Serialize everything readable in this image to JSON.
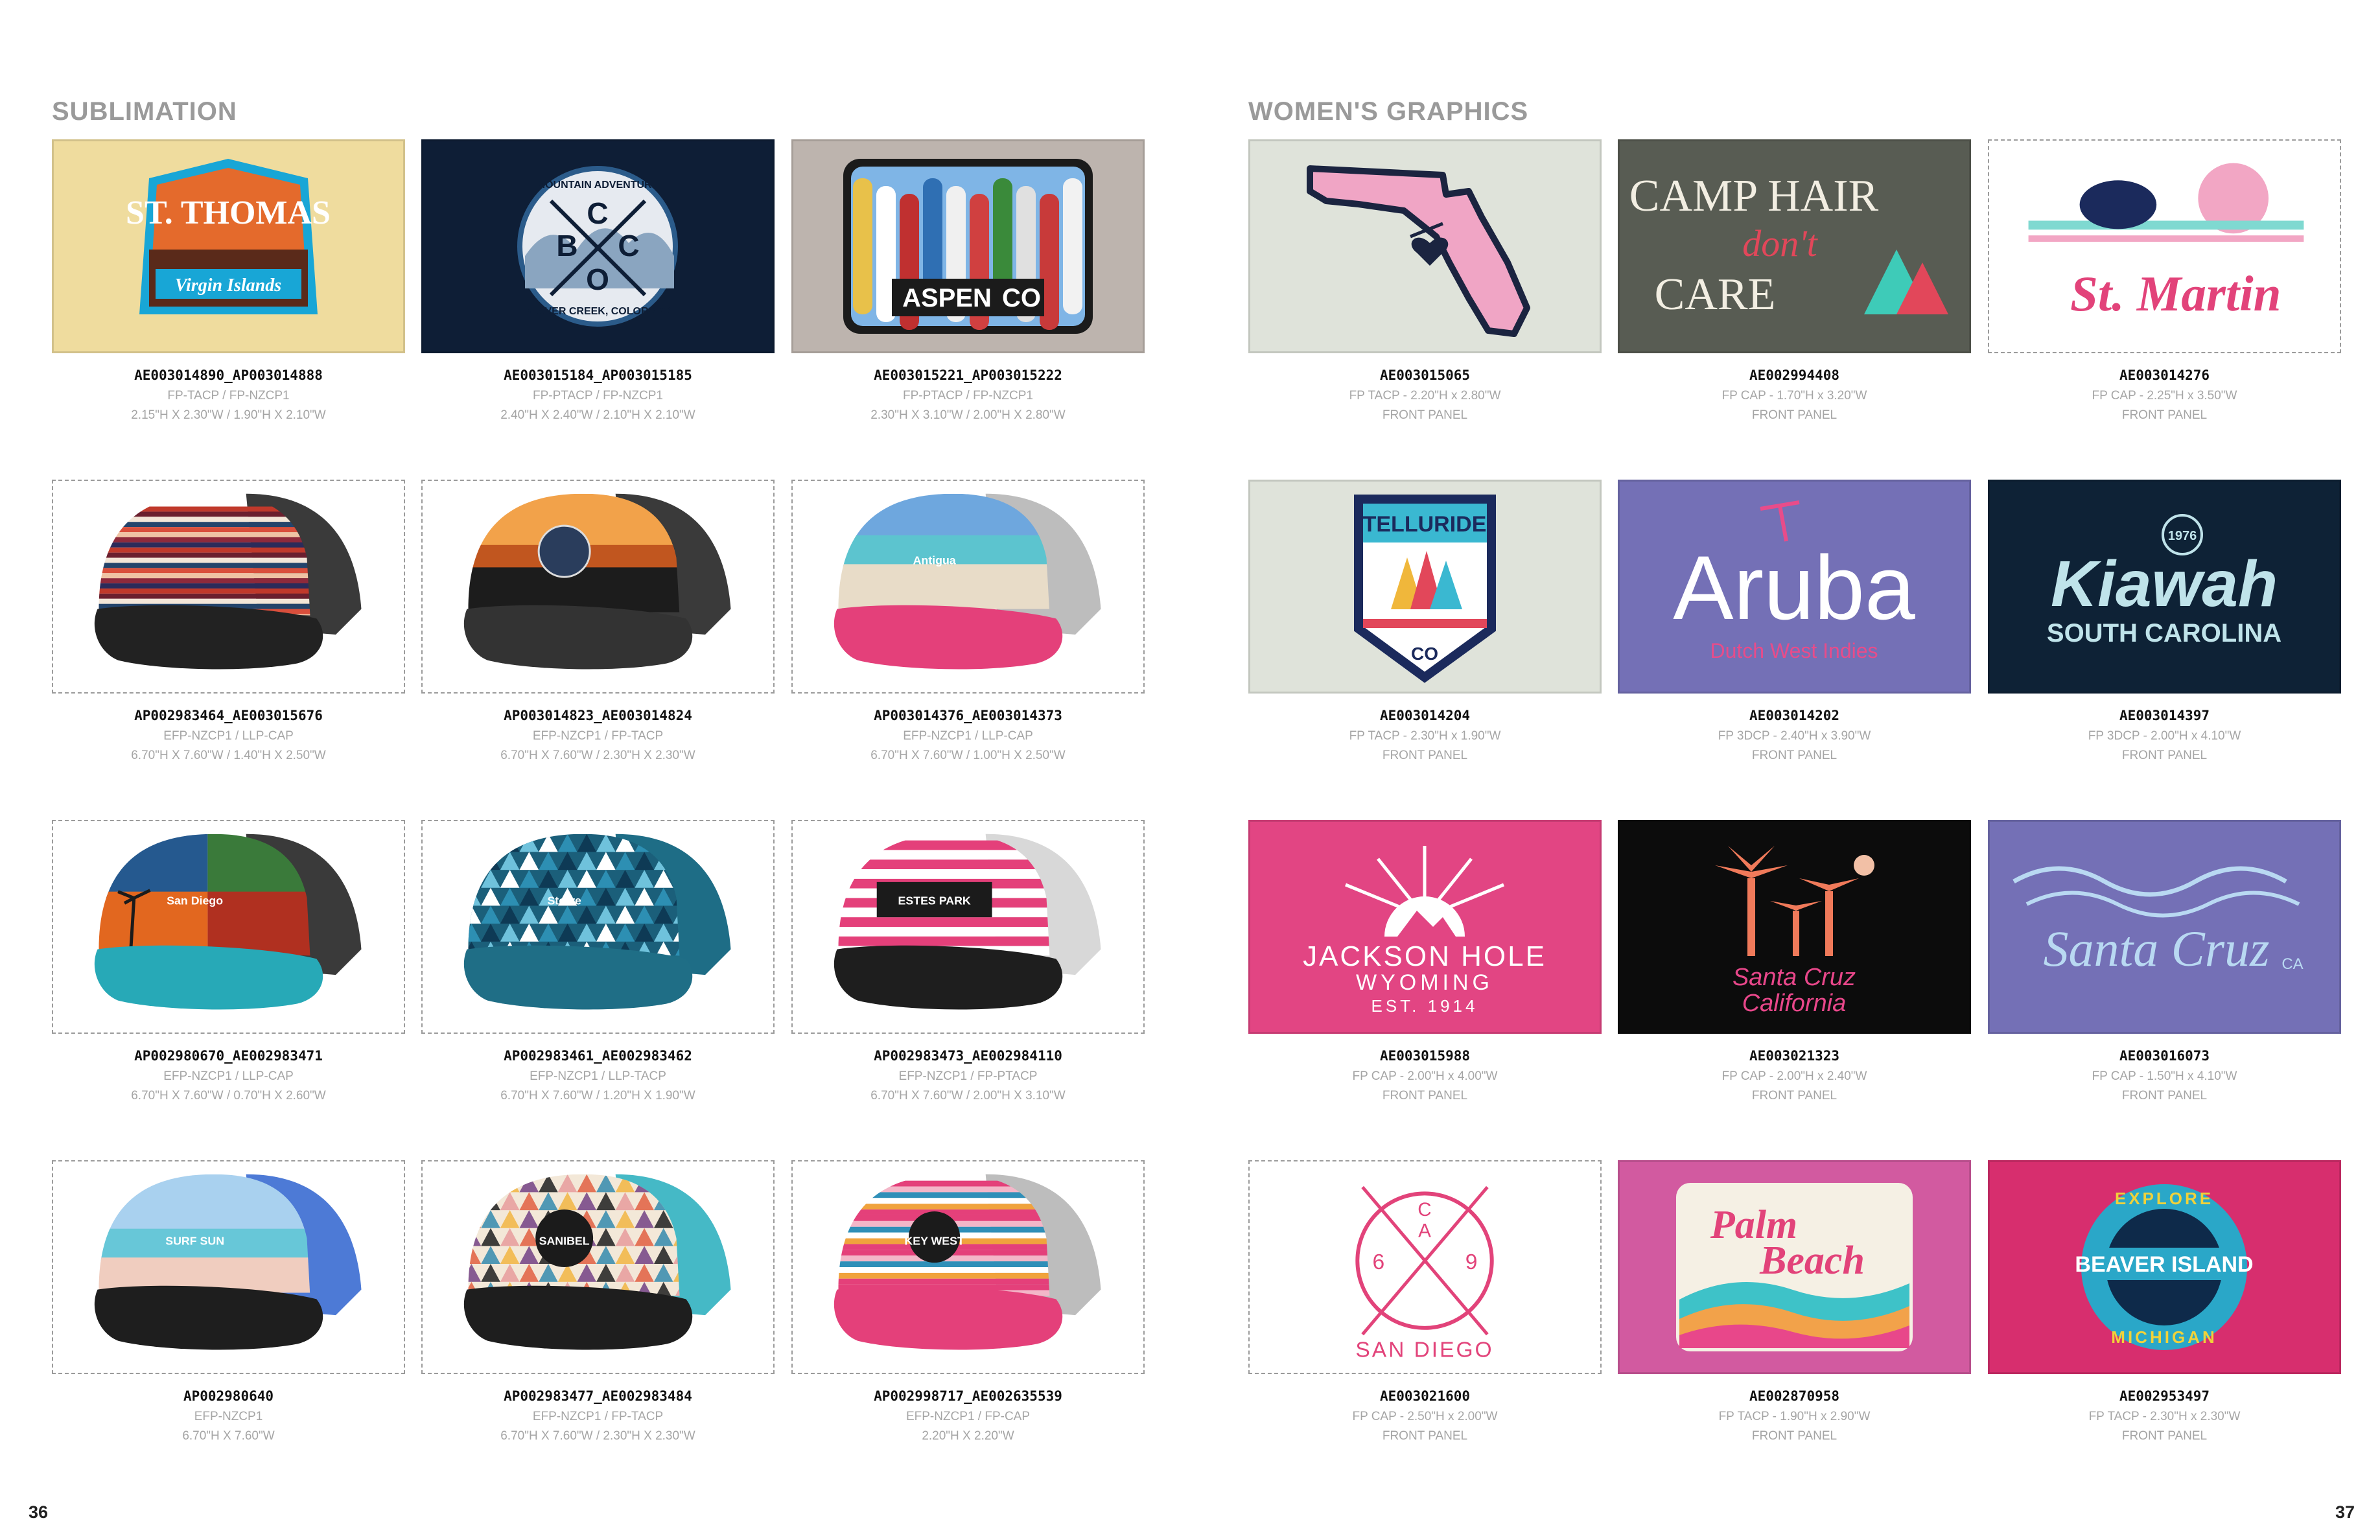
{
  "left_page": {
    "title": "SUBLIMATION",
    "page_number": "36",
    "items": [
      {
        "id": "AE003014890_AP003014888",
        "line1": "FP-TACP / FP-NZCP1",
        "line2": "2.15\"H X 2.30\"W / 1.90\"H X 2.10\"W",
        "art": {
          "kind": "stthomas",
          "text1": "ST. THOMAS",
          "text2": "Virgin Islands",
          "bg": "#efdc9e"
        }
      },
      {
        "id": "AE003015184_AP003015185",
        "line1": "FP-PTACP / FP-NZCP1",
        "line2": "2.40\"H X 2.40\"W / 2.10\"H X 2.10\"W",
        "art": {
          "kind": "bcco",
          "text1": "MOUNTAIN ADVENTURE",
          "text2": "BEAVER CREEK, COLORADO",
          "letters": [
            "B",
            "C",
            "C",
            "O"
          ],
          "bg": "#0e1e36"
        }
      },
      {
        "id": "AE003015221_AP003015222",
        "line1": "FP-PTACP / FP-NZCP1",
        "line2": "2.30\"H X 3.10\"W / 2.00\"H X 2.80\"W",
        "art": {
          "kind": "aspen",
          "text1": "ASPEN",
          "text2": "CO",
          "bg": "#bdb4ae"
        }
      },
      {
        "id": "AP002983464_AE003015676",
        "line1": "EFP-NZCP1 / LLP-CAP",
        "line2": "6.70\"H X 7.60\"W / 1.40\"H X 2.50\"W",
        "art": {
          "kind": "cap",
          "pattern": "serape",
          "mesh": "#3a3a3a",
          "bill": "#222222"
        }
      },
      {
        "id": "AP003014823_AE003014824",
        "line1": "EFP-NZCP1 / FP-TACP",
        "line2": "6.70\"H X 7.60\"W / 2.30\"H X 2.30\"W",
        "art": {
          "kind": "cap",
          "pattern": "sunset",
          "mesh": "#3a3a3a",
          "bill": "#333333"
        }
      },
      {
        "id": "AP003014376_AE003014373",
        "line1": "EFP-NZCP1 / LLP-CAP",
        "line2": "6.70\"H X 7.60\"W / 1.00\"H X 2.50\"W",
        "art": {
          "kind": "cap",
          "pattern": "beach",
          "mesh": "#bdbdbd",
          "bill": "#e4407a",
          "label": "Antigua"
        }
      },
      {
        "id": "AP002980670_AE002983471",
        "line1": "EFP-NZCP1 / LLP-CAP",
        "line2": "6.70\"H X 7.60\"W / 0.70\"H X 2.60\"W",
        "art": {
          "kind": "cap",
          "pattern": "collage",
          "mesh": "#3a3a3a",
          "bill": "#27a9b7",
          "label": "San Diego"
        }
      },
      {
        "id": "AP002983461_AE002983462",
        "line1": "EFP-NZCP1 / LLP-TACP",
        "line2": "6.70\"H X 7.60\"W / 1.20\"H X 1.90\"W",
        "art": {
          "kind": "cap",
          "pattern": "triangles",
          "mesh": "#1e6d86",
          "bill": "#1f6e86",
          "label": "Stowe"
        }
      },
      {
        "id": "AP002983473_AE002984110",
        "line1": "EFP-NZCP1 / FP-PTACP",
        "line2": "6.70\"H X 7.60\"W / 2.00\"H X 3.10\"W",
        "art": {
          "kind": "cap",
          "pattern": "pinkstripe",
          "mesh": "#d8d8d8",
          "bill": "#1e1e1e",
          "label": "ESTES PARK"
        }
      },
      {
        "id": "AP002980640",
        "line1": "EFP-NZCP1",
        "line2": "6.70\"H X 7.60\"W",
        "art": {
          "kind": "cap",
          "pattern": "surf",
          "mesh": "#4d7ad6",
          "bill": "#1e1e1e",
          "label": "SURF SUN"
        }
      },
      {
        "id": "AP002983477_AE002983484",
        "line1": "EFP-NZCP1 / FP-TACP",
        "line2": "6.70\"H X 7.60\"W / 2.30\"H X 2.30\"W",
        "art": {
          "kind": "cap",
          "pattern": "triangles2",
          "mesh": "#45b9c6",
          "bill": "#1e1e1e",
          "label": "SANIBEL"
        }
      },
      {
        "id": "AP002998717_AE002635539",
        "line1": "EFP-NZCP1 / FP-CAP",
        "line2": "2.20\"H X 2.20\"W",
        "art": {
          "kind": "cap",
          "pattern": "pinkserape",
          "mesh": "#bdbdbd",
          "bill": "#e4407a",
          "label": "KEY WEST"
        }
      }
    ]
  },
  "right_page": {
    "title": "WOMEN'S GRAPHICS",
    "page_number": "37",
    "items": [
      {
        "id": "AE003015065",
        "line1": "FP TACP - 2.20\"H x 2.80\"W",
        "line2": "FRONT PANEL",
        "art": {
          "kind": "florida",
          "bg": "#dfe3da"
        }
      },
      {
        "id": "AE002994408",
        "line1": "FP CAP - 1.70\"H x 3.20\"W",
        "line2": "FRONT PANEL",
        "art": {
          "kind": "camphair",
          "text1": "CAMP HAIR",
          "text2": "don't",
          "text3": "CARE",
          "bg": "#585c53"
        }
      },
      {
        "id": "AE003014276",
        "line1": "FP CAP - 2.25\"H x 3.50\"W",
        "line2": "FRONT PANEL",
        "art": {
          "kind": "stmartin",
          "text1": "St. Martin",
          "bg": "#ffffff"
        }
      },
      {
        "id": "AE003014204",
        "line1": "FP TACP - 2.30\"H x 1.90\"W",
        "line2": "FRONT PANEL",
        "art": {
          "kind": "telluride",
          "text1": "TELLURIDE",
          "text2": "CO",
          "bg": "#dfe3da"
        }
      },
      {
        "id": "AE003014202",
        "line1": "FP 3DCP - 2.40\"H x 3.90\"W",
        "line2": "FRONT PANEL",
        "art": {
          "kind": "aruba",
          "text1": "Aruba",
          "text2": "Dutch West Indies",
          "bg": "#7470b6"
        }
      },
      {
        "id": "AE003014397",
        "line1": "FP 3DCP - 2.00\"H x 4.10\"W",
        "line2": "FRONT PANEL",
        "art": {
          "kind": "kiawah",
          "text1": "Kiawah",
          "text2": "SOUTH CAROLINA",
          "text3": "1976",
          "bg": "#0e2236"
        }
      },
      {
        "id": "AE003015988",
        "line1": "FP CAP - 2.00\"H x 4.00\"W",
        "line2": "FRONT PANEL",
        "art": {
          "kind": "jackson",
          "text1": "JACKSON HOLE",
          "text2": "WYOMING",
          "text3": "EST. 1914",
          "bg": "#e24583"
        }
      },
      {
        "id": "AE003021323",
        "line1": "FP CAP - 2.00\"H x 2.40\"W",
        "line2": "FRONT PANEL",
        "art": {
          "kind": "santacruzpalm",
          "text1": "Santa Cruz",
          "text2": "California",
          "bg": "#0c0c0c"
        }
      },
      {
        "id": "AE003016073",
        "line1": "FP CAP - 1.50\"H x 4.10\"W",
        "line2": "FRONT PANEL",
        "art": {
          "kind": "santacruzwave",
          "text1": "Santa Cruz",
          "text2": "CA",
          "bg": "#7470b6"
        }
      },
      {
        "id": "AE003021600",
        "line1": "FP CAP - 2.50\"H x 2.00\"W",
        "line2": "FRONT PANEL",
        "art": {
          "kind": "sandiego",
          "text1": "SAN DIEGO",
          "letters": [
            "C",
            "A",
            "6",
            "9"
          ],
          "bg": "#ffffff"
        }
      },
      {
        "id": "AE002870958",
        "line1": "FP TACP - 1.90\"H x 2.90\"W",
        "line2": "FRONT PANEL",
        "art": {
          "kind": "palmbeach",
          "text1": "Palm",
          "text2": "Beach",
          "bg": "#d25aa0"
        }
      },
      {
        "id": "AE002953497",
        "line1": "FP TACP - 2.30\"H x 2.30\"W",
        "line2": "FRONT PANEL",
        "art": {
          "kind": "beaverisland",
          "text1": "BEAVER ISLAND",
          "text2": "EXPLORE",
          "text3": "MICHIGAN",
          "bg": "#d72e6e"
        }
      }
    ]
  }
}
